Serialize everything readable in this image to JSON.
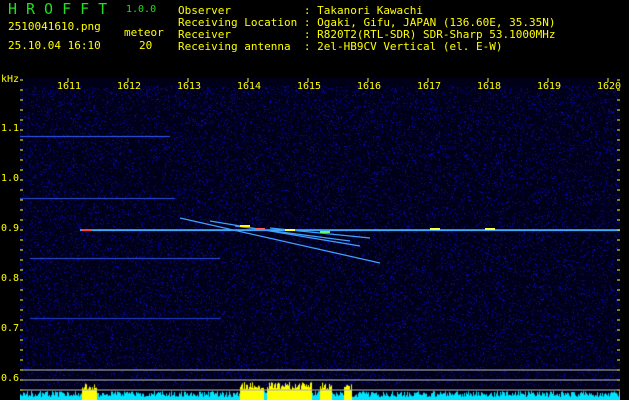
{
  "header": {
    "app_title": "HROFFT",
    "version": "1.0.0",
    "filename": "2510041610.png",
    "datetime": "25.10.04 16:10",
    "meteor_label": "meteor",
    "meteor_count": "20"
  },
  "info": [
    {
      "label": "Observer           ",
      "value": ": Takanori Kawachi"
    },
    {
      "label": "Receiving Location ",
      "value": ": Ogaki, Gifu, JAPAN (136.60E, 35.35N)"
    },
    {
      "label": "Receiver           ",
      "value": ": R820T2(RTL-SDR) SDR-Sharp 53.1000MHz"
    },
    {
      "label": "Receiving antenna  ",
      "value": ": 2el-HB9CV Vertical (el. E-W)"
    }
  ],
  "axis": {
    "y_unit": "kHz",
    "x_ticks": [
      "1611",
      "1612",
      "1613",
      "1614",
      "1615",
      "1616",
      "1617",
      "1618",
      "1619",
      "1620"
    ],
    "y_ticks": [
      "1.1",
      "1.0",
      "0.9",
      "0.8",
      "0.7",
      "0.6"
    ]
  },
  "colors": {
    "text": "#ffff00",
    "title": "#22dd22",
    "background": "#000000",
    "noise": "#1010a0",
    "histogram": "#00e5ff",
    "meteor_bars": "#ffff00"
  }
}
